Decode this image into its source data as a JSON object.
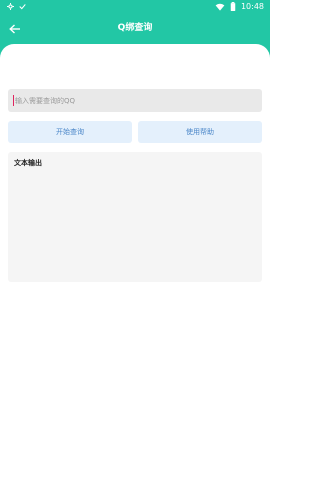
{
  "status_bar": {
    "time": "10:48",
    "left_icons": [
      "settings-icon",
      "check-icon"
    ],
    "right_icons": [
      "wifi-icon",
      "battery-icon"
    ]
  },
  "app_bar": {
    "title": "Q绑查询",
    "back_icon": "arrow-left-icon"
  },
  "query": {
    "placeholder": "输入需要查询的QQ",
    "value": ""
  },
  "buttons": {
    "start": "开始查询",
    "help": "使用帮助"
  },
  "output": {
    "label": "文本输出",
    "text": ""
  },
  "colors": {
    "accent": "#22c7a5",
    "button_bg": "#e4f0fc",
    "button_text": "#4a86c8",
    "input_bg": "#e9e9e9",
    "output_bg": "#f5f5f5"
  }
}
